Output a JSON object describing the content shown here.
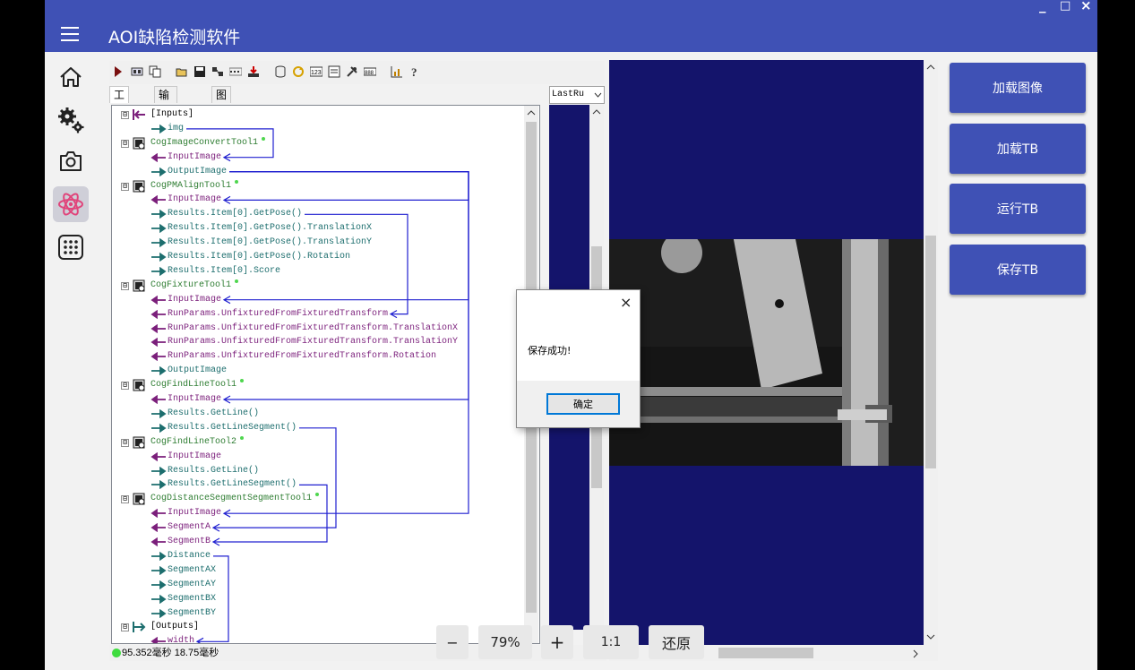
{
  "window": {
    "controls": [
      "_",
      "□",
      "×"
    ]
  },
  "app": {
    "title": "AOI缺陷检测软件"
  },
  "sidebar": {
    "items": [
      {
        "icon": "home-icon",
        "active": false
      },
      {
        "icon": "gears-icon",
        "active": false
      },
      {
        "icon": "camera-icon",
        "active": false
      },
      {
        "icon": "atom-icon",
        "active": true
      },
      {
        "icon": "grid-icon",
        "active": false
      }
    ]
  },
  "editor": {
    "tabs": [
      "工具",
      "输入/输出",
      "图形"
    ],
    "selected_tab": "工具",
    "lastrun_select": "LastRu",
    "tree": [
      {
        "kind": "hdr",
        "label": "[Inputs]",
        "dir": "in",
        "expander": "⊟"
      },
      {
        "kind": "out",
        "label": "img"
      },
      {
        "kind": "tool",
        "label": "CogImageConvertTool1",
        "expander": "⊟"
      },
      {
        "kind": "in",
        "label": "InputImage"
      },
      {
        "kind": "out",
        "label": "OutputImage"
      },
      {
        "kind": "tool",
        "label": "CogPMAlignTool1",
        "expander": "⊟"
      },
      {
        "kind": "in",
        "label": "InputImage"
      },
      {
        "kind": "out",
        "label": "Results.Item[0].GetPose()"
      },
      {
        "kind": "out",
        "label": "Results.Item[0].GetPose().TranslationX"
      },
      {
        "kind": "out",
        "label": "Results.Item[0].GetPose().TranslationY"
      },
      {
        "kind": "out",
        "label": "Results.Item[0].GetPose().Rotation"
      },
      {
        "kind": "out",
        "label": "Results.Item[0].Score"
      },
      {
        "kind": "tool",
        "label": "CogFixtureTool1",
        "expander": "⊟"
      },
      {
        "kind": "in",
        "label": "InputImage"
      },
      {
        "kind": "in",
        "label": "RunParams.UnfixturedFromFixturedTransform"
      },
      {
        "kind": "in",
        "label": "RunParams.UnfixturedFromFixturedTransform.TranslationX"
      },
      {
        "kind": "in",
        "label": "RunParams.UnfixturedFromFixturedTransform.TranslationY"
      },
      {
        "kind": "in",
        "label": "RunParams.UnfixturedFromFixturedTransform.Rotation"
      },
      {
        "kind": "out",
        "label": "OutputImage"
      },
      {
        "kind": "tool",
        "label": "CogFindLineTool1",
        "expander": "⊟"
      },
      {
        "kind": "in",
        "label": "InputImage"
      },
      {
        "kind": "out",
        "label": "Results.GetLine()"
      },
      {
        "kind": "out",
        "label": "Results.GetLineSegment()"
      },
      {
        "kind": "tool",
        "label": "CogFindLineTool2",
        "expander": "⊟"
      },
      {
        "kind": "in",
        "label": "InputImage"
      },
      {
        "kind": "out",
        "label": "Results.GetLine()"
      },
      {
        "kind": "out",
        "label": "Results.GetLineSegment()"
      },
      {
        "kind": "tool",
        "label": "CogDistanceSegmentSegmentTool1",
        "expander": "⊟"
      },
      {
        "kind": "in",
        "label": "InputImage"
      },
      {
        "kind": "in",
        "label": "SegmentA"
      },
      {
        "kind": "in",
        "label": "SegmentB"
      },
      {
        "kind": "out",
        "label": "Distance"
      },
      {
        "kind": "out",
        "label": "SegmentAX"
      },
      {
        "kind": "out",
        "label": "SegmentAY"
      },
      {
        "kind": "out",
        "label": "SegmentBX"
      },
      {
        "kind": "out",
        "label": "SegmentBY"
      },
      {
        "kind": "hdr",
        "label": "[Outputs]",
        "dir": "out",
        "expander": "⊟"
      },
      {
        "kind": "in",
        "label": "width"
      }
    ],
    "status": "95.352毫秒 18.75毫秒"
  },
  "zoom": {
    "minus": "−",
    "value": "79%",
    "plus": "+",
    "ratio": "1:1",
    "reset": "还原"
  },
  "actions": [
    "加载图像",
    "加载TB",
    "运行TB",
    "保存TB"
  ],
  "dialog": {
    "close": "×",
    "message": "保存成功!",
    "ok": "确定"
  },
  "colors": {
    "brand": "#3f51b5",
    "image_bg": "#14146b",
    "link_line": "#2020d0",
    "input_arrow": "#7b1f7b",
    "output_arrow": "#1d6e6e",
    "tool_text": "#2e7d32"
  }
}
